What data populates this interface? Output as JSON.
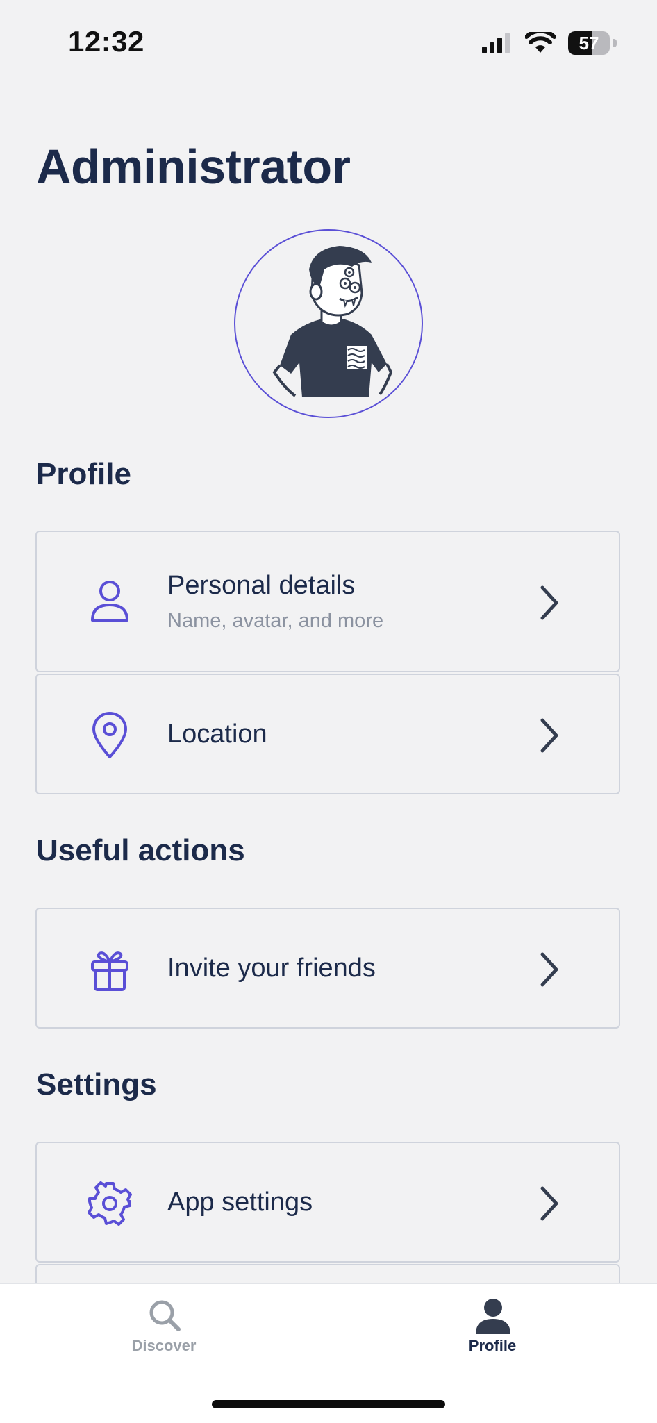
{
  "status_bar": {
    "time": "12:32",
    "battery": "57",
    "battery_level": 0.57,
    "icons": [
      "cellular-signal-icon",
      "wifi-icon",
      "battery-icon"
    ]
  },
  "page": {
    "title": "Administrator"
  },
  "avatar": {
    "icon": "avatar-illustration"
  },
  "sections": {
    "profile": {
      "heading": "Profile",
      "items": [
        {
          "title": "Personal details",
          "subtitle": "Name, avatar, and more",
          "icon": "person-icon"
        },
        {
          "title": "Location",
          "icon": "location-pin-icon"
        }
      ]
    },
    "useful_actions": {
      "heading": "Useful actions",
      "items": [
        {
          "title": "Invite your friends",
          "icon": "gift-icon"
        }
      ]
    },
    "settings": {
      "heading": "Settings",
      "items": [
        {
          "title": "App settings",
          "icon": "gear-icon"
        }
      ]
    }
  },
  "tabbar": {
    "tabs": [
      {
        "label": "Discover",
        "icon": "search-icon",
        "active": false
      },
      {
        "label": "Profile",
        "icon": "profile-icon",
        "active": true
      }
    ]
  },
  "colors": {
    "background": "#f2f2f3",
    "primary_text": "#1c2a4a",
    "accent": "#5a4fd6",
    "secondary_text": "#8b92a0",
    "tab_inactive": "#9aa0a8"
  }
}
